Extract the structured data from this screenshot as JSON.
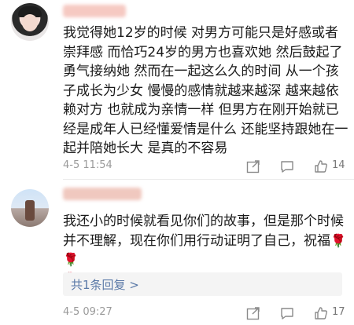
{
  "comments": [
    {
      "text": "我觉得她12岁的时候 对男方可能只是好感或者崇拜感 而恰巧24岁的男方也喜欢她 然后鼓起了勇气接纳她 然而在一起这么久的时间 从一个孩子成长为少女 慢慢的感情就越来越深 越来越依赖对方 也就成为亲情一样 但男方在刚开始就已经是成年人已经懂爱情是什么 还能坚持跟她在一起并陪她长大 是真的不容易",
      "time": "4-5 11:54",
      "likes": "14"
    },
    {
      "text": "我还小的时候就看见你们的故事，但是那个时候并不理解，现在你们用行动证明了自己，祝福",
      "roses": [
        "🌹",
        "🌹",
        "🌹"
      ],
      "reply_link": "共1条回复 >",
      "time": "4-5 09:27",
      "likes": "17"
    }
  ],
  "icons": {
    "share": "share-icon",
    "comment": "comment-icon",
    "like": "thumbs-up-icon",
    "accent": "#5b7aa8",
    "rose": "#d4202a"
  }
}
